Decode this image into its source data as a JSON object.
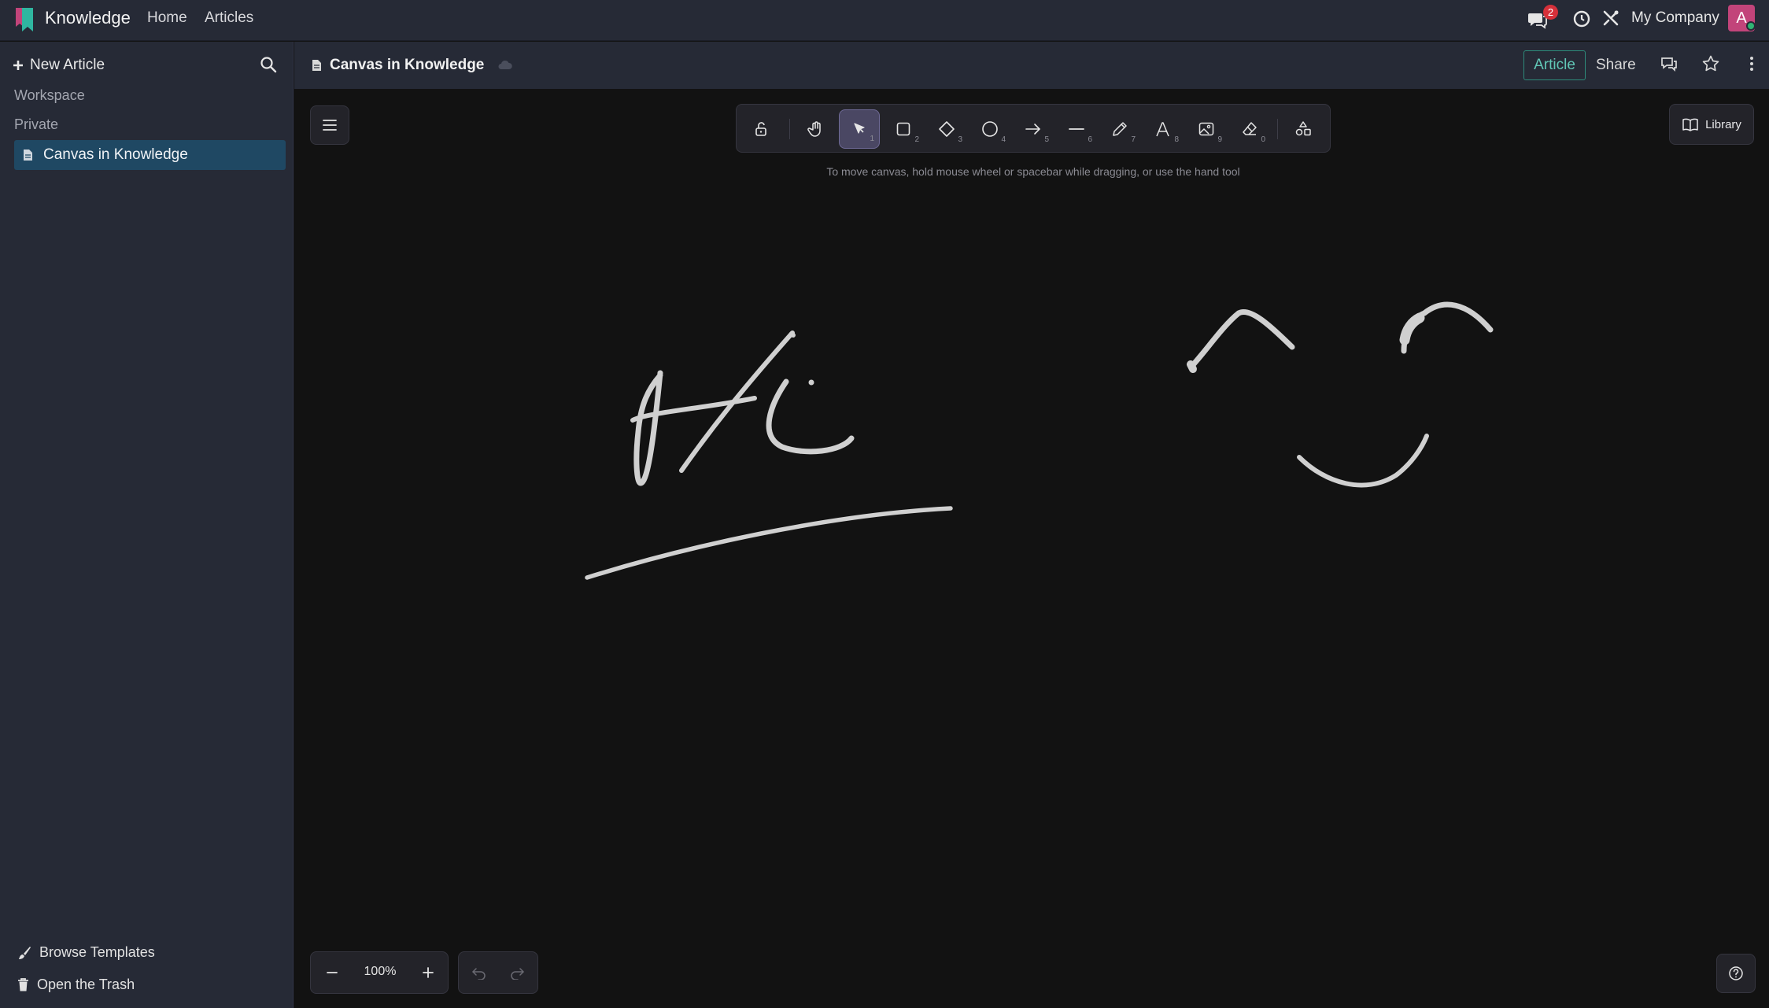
{
  "topbar": {
    "app_name": "Knowledge",
    "nav": [
      "Home",
      "Articles"
    ],
    "messages_badge": "2",
    "company": "My Company",
    "avatar_letter": "A",
    "accent_color": "#61c7b6"
  },
  "sidebar": {
    "new_article": "New Article",
    "sections": [
      "Workspace",
      "Private"
    ],
    "active_item": "Canvas in Knowledge",
    "browse_templates": "Browse Templates",
    "open_trash": "Open the Trash"
  },
  "article": {
    "title": "Canvas in Knowledge",
    "article_button": "Article",
    "share_button": "Share"
  },
  "canvas": {
    "tools": [
      {
        "name": "lock-icon",
        "num": ""
      },
      {
        "name": "hand-icon",
        "num": ""
      },
      {
        "name": "selection-icon",
        "num": "1"
      },
      {
        "name": "rectangle-icon",
        "num": "2"
      },
      {
        "name": "diamond-icon",
        "num": "3"
      },
      {
        "name": "ellipse-icon",
        "num": "4"
      },
      {
        "name": "arrow-icon",
        "num": "5"
      },
      {
        "name": "line-icon",
        "num": "6"
      },
      {
        "name": "pencil-icon",
        "num": "7"
      },
      {
        "name": "text-icon",
        "num": "8"
      },
      {
        "name": "image-icon",
        "num": "9"
      },
      {
        "name": "eraser-icon",
        "num": "0"
      },
      {
        "name": "shapes-icon",
        "num": ""
      }
    ],
    "selected_tool": "selection",
    "hint": "To move canvas, hold mouse wheel or spacebar while dragging, or use the hand tool",
    "library": "Library",
    "zoom": "100%"
  }
}
